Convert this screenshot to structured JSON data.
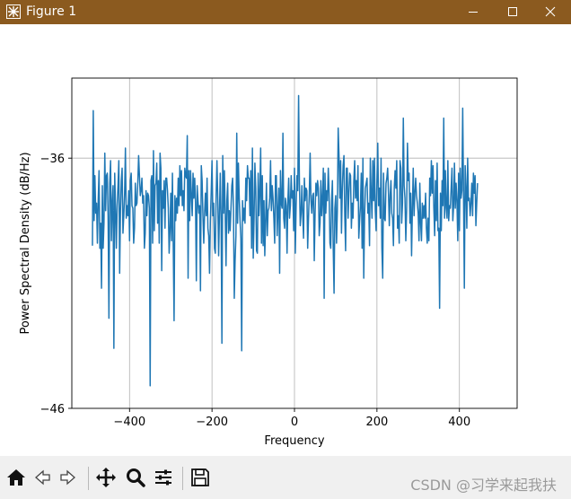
{
  "window": {
    "title": "Figure 1"
  },
  "toolbar": {
    "buttons": [
      "home-icon",
      "back-icon",
      "forward-icon",
      "pan-icon",
      "zoom-icon",
      "configure-subplots-icon",
      "save-icon"
    ]
  },
  "watermark": "CSDN @习学来起我扶",
  "colors": {
    "titlebar": "#8b5a1f",
    "line": "#1f77b4",
    "grid": "#b0b0b0",
    "toolbar": "#f0f0f0"
  },
  "chart_data": {
    "type": "line",
    "title": "",
    "xlabel": "Frequency",
    "ylabel": "Power Spectral Density (dB/Hz)",
    "xlim": [
      -540,
      540
    ],
    "ylim": [
      -46,
      -32.8
    ],
    "xticks": [
      -400,
      -200,
      0,
      200,
      400
    ],
    "xtick_labels": [
      "−400",
      "−200",
      "0",
      "200",
      "400"
    ],
    "yticks": [
      -36,
      -46
    ],
    "ytick_labels": [
      "−36",
      "−46"
    ],
    "grid": true,
    "series": [
      {
        "x_start": -490,
        "x_step": 2,
        "y": [
          -39.5,
          -34.1,
          -38.5,
          -36.7,
          -38.2,
          -37.8,
          -39.4,
          -37.7,
          -36.5,
          -39.6,
          -38.6,
          -41.2,
          -37.1,
          -39.6,
          -38.6,
          -35.8,
          -38.1,
          -36.7,
          -36.6,
          -38.3,
          -42.4,
          -37.0,
          -36.1,
          -39.3,
          -37.8,
          -37.1,
          -43.6,
          -36.6,
          -38.0,
          -39.6,
          -37.9,
          -37.1,
          -36.1,
          -40.6,
          -38.1,
          -36.9,
          -36.4,
          -39.0,
          -38.3,
          -37.4,
          -35.6,
          -38.4,
          -37.9,
          -38.3,
          -37.3,
          -39.3,
          -36.9,
          -36.6,
          -37.9,
          -38.0,
          -39.4,
          -38.8,
          -37.0,
          -37.9,
          -37.8,
          -37.0,
          -35.9,
          -36.7,
          -37.5,
          -37.3,
          -36.8,
          -37.8,
          -37.5,
          -39.6,
          -39.0,
          -37.3,
          -38.3,
          -37.4,
          -37.5,
          -38.0,
          -45.1,
          -36.9,
          -36.7,
          -39.4,
          -35.7,
          -38.9,
          -37.1,
          -37.0,
          -36.2,
          -38.6,
          -36.9,
          -39.4,
          -35.8,
          -36.4,
          -40.5,
          -37.3,
          -38.0,
          -36.9,
          -38.8,
          -36.8,
          -36.8,
          -37.3,
          -38.0,
          -39.8,
          -38.9,
          -37.4,
          -39.3,
          -36.6,
          -39.5,
          -42.5,
          -37.5,
          -38.5,
          -37.6,
          -38.2,
          -36.8,
          -37.9,
          -36.3,
          -37.5,
          -36.5,
          -37.9,
          -37.3,
          -38.1,
          -36.4,
          -36.7,
          -36.8,
          -35.1,
          -40.8,
          -36.5,
          -38.5,
          -36.5,
          -37.5,
          -38.3,
          -36.6,
          -37.6,
          -36.8,
          -37.8,
          -40.9,
          -37.1,
          -37.7,
          -38.2,
          -37.9,
          -41.3,
          -36.3,
          -36.9,
          -38.3,
          -39.4,
          -38.2,
          -37.4,
          -38.3,
          -36.8,
          -38.8,
          -39.1,
          -40.6,
          -38.5,
          -37.4,
          -36.1,
          -38.3,
          -37.8,
          -39.6,
          -39.8,
          -37.5,
          -36.1,
          -37.6,
          -39.9,
          -38.3,
          -36.6,
          -38.3,
          -43.4,
          -35.9,
          -38.2,
          -36.5,
          -38.2,
          -40.3,
          -37.7,
          -37.0,
          -39.0,
          -38.1,
          -38.9,
          -38.0,
          -37.1,
          -36.8,
          -38.0,
          -41.6,
          -40.1,
          -39.1,
          -35.0,
          -38.6,
          -36.2,
          -37.6,
          -38.5,
          -39.2,
          -43.7,
          -37.7,
          -38.5,
          -38.0,
          -38.6,
          -36.8,
          -37.7,
          -36.3,
          -36.8,
          -36.8,
          -38.3,
          -36.5,
          -39.6,
          -35.6,
          -40.0,
          -38.4,
          -36.2,
          -37.2,
          -39.7,
          -39.8,
          -36.6,
          -38.3,
          -37.4,
          -35.6,
          -39.4,
          -36.7,
          -39.5,
          -37.7,
          -39.9,
          -38.5,
          -37.0,
          -39.1,
          -38.1,
          -38.0,
          -37.6,
          -36.1,
          -38.1,
          -37.1,
          -37.6,
          -38.4,
          -39.4,
          -36.7,
          -36.7,
          -39.1,
          -38.1,
          -37.2,
          -40.6,
          -36.5,
          -37.8,
          -38.0,
          -35.0,
          -38.4,
          -38.8,
          -37.6,
          -37.9,
          -39.8,
          -37.7,
          -36.8,
          -38.4,
          -37.9,
          -36.7,
          -37.6,
          -37.3,
          -38.9,
          -36.4,
          -39.8,
          -37.9,
          -36.7,
          -37.3,
          -33.5,
          -37.0,
          -38.7,
          -38.2,
          -37.1,
          -38.3,
          -39.2,
          -36.8,
          -37.7,
          -37.2,
          -37.3,
          -39.6,
          -38.4,
          -37.4,
          -35.8,
          -37.7,
          -38.2,
          -37.5,
          -37.4,
          -40.1,
          -38.2,
          -37.0,
          -37.5,
          -36.9,
          -37.2,
          -39.1,
          -38.6,
          -36.9,
          -38.3,
          -37.6,
          -36.4,
          -41.6,
          -36.6,
          -38.2,
          -37.3,
          -37.7,
          -36.4,
          -37.4,
          -39.4,
          -39.6,
          -37.7,
          -36.9,
          -39.6,
          -41.4,
          -38.0,
          -37.5,
          -39.4,
          -38.1,
          -34.8,
          -35.9,
          -37.6,
          -36.1,
          -39.0,
          -37.3,
          -36.3,
          -35.9,
          -38.3,
          -39.7,
          -36.4,
          -36.4,
          -38.4,
          -37.4,
          -36.6,
          -36.7,
          -38.8,
          -37.8,
          -38.4,
          -36.9,
          -36.1,
          -37.6,
          -36.9,
          -37.7,
          -36.3,
          -39.2,
          -38.5,
          -37.9,
          -36.6,
          -39.6,
          -36.0,
          -40.8,
          -38.3,
          -37.2,
          -37.0,
          -36.8,
          -38.2,
          -37.8,
          -39.5,
          -36.0,
          -37.4,
          -38.4,
          -36.1,
          -37.7,
          -36.0,
          -38.1,
          -38.9,
          -36.9,
          -35.4,
          -37.9,
          -37.2,
          -38.4,
          -36.0,
          -39.6,
          -40.8,
          -36.6,
          -38.4,
          -38.5,
          -37.0,
          -36.8,
          -36.4,
          -37.4,
          -38.7,
          -37.5,
          -36.9,
          -38.2,
          -38.4,
          -39.5,
          -37.2,
          -36.5,
          -37.2,
          -36.1,
          -38.8,
          -38.3,
          -39.4,
          -36.1,
          -36.4,
          -38.6,
          -37.8,
          -34.4,
          -37.1,
          -37.6,
          -39.3,
          -38.1,
          -35.4,
          -36.9,
          -36.6,
          -38.6,
          -37.4,
          -39.9,
          -38.0,
          -36.4,
          -38.3,
          -37.4,
          -36.8,
          -37.5,
          -37.8,
          -38.2,
          -39.3,
          -37.0,
          -38.6,
          -39.3,
          -37.8,
          -38.4,
          -37.9,
          -38.4,
          -37.4,
          -38.8,
          -39.4,
          -38.4,
          -39.3,
          -36.8,
          -37.5,
          -36.1,
          -37.4,
          -36.3,
          -38.0,
          -39.1,
          -36.9,
          -38.5,
          -36.2,
          -38.9,
          -38.8,
          -42.0,
          -37.4,
          -38.9,
          -36.9,
          -37.9,
          -34.4,
          -38.4,
          -36.5,
          -38.0,
          -38.4,
          -36.1,
          -38.5,
          -37.9,
          -38.0,
          -37.2,
          -36.4,
          -38.5,
          -37.9,
          -36.2,
          -38.0,
          -37.0,
          -37.7,
          -39.3,
          -36.6,
          -38.9,
          -36.4,
          -37.6,
          -37.3,
          -34.0,
          -37.4,
          -41.2,
          -36.3,
          -37.2,
          -38.8,
          -36.0,
          -37.7,
          -37.6,
          -38.3,
          -37.8,
          -37.0,
          -38.3,
          -36.6,
          -37.4,
          -36.7,
          -38.7,
          -37.8,
          -37.0
        ]
      }
    ]
  }
}
